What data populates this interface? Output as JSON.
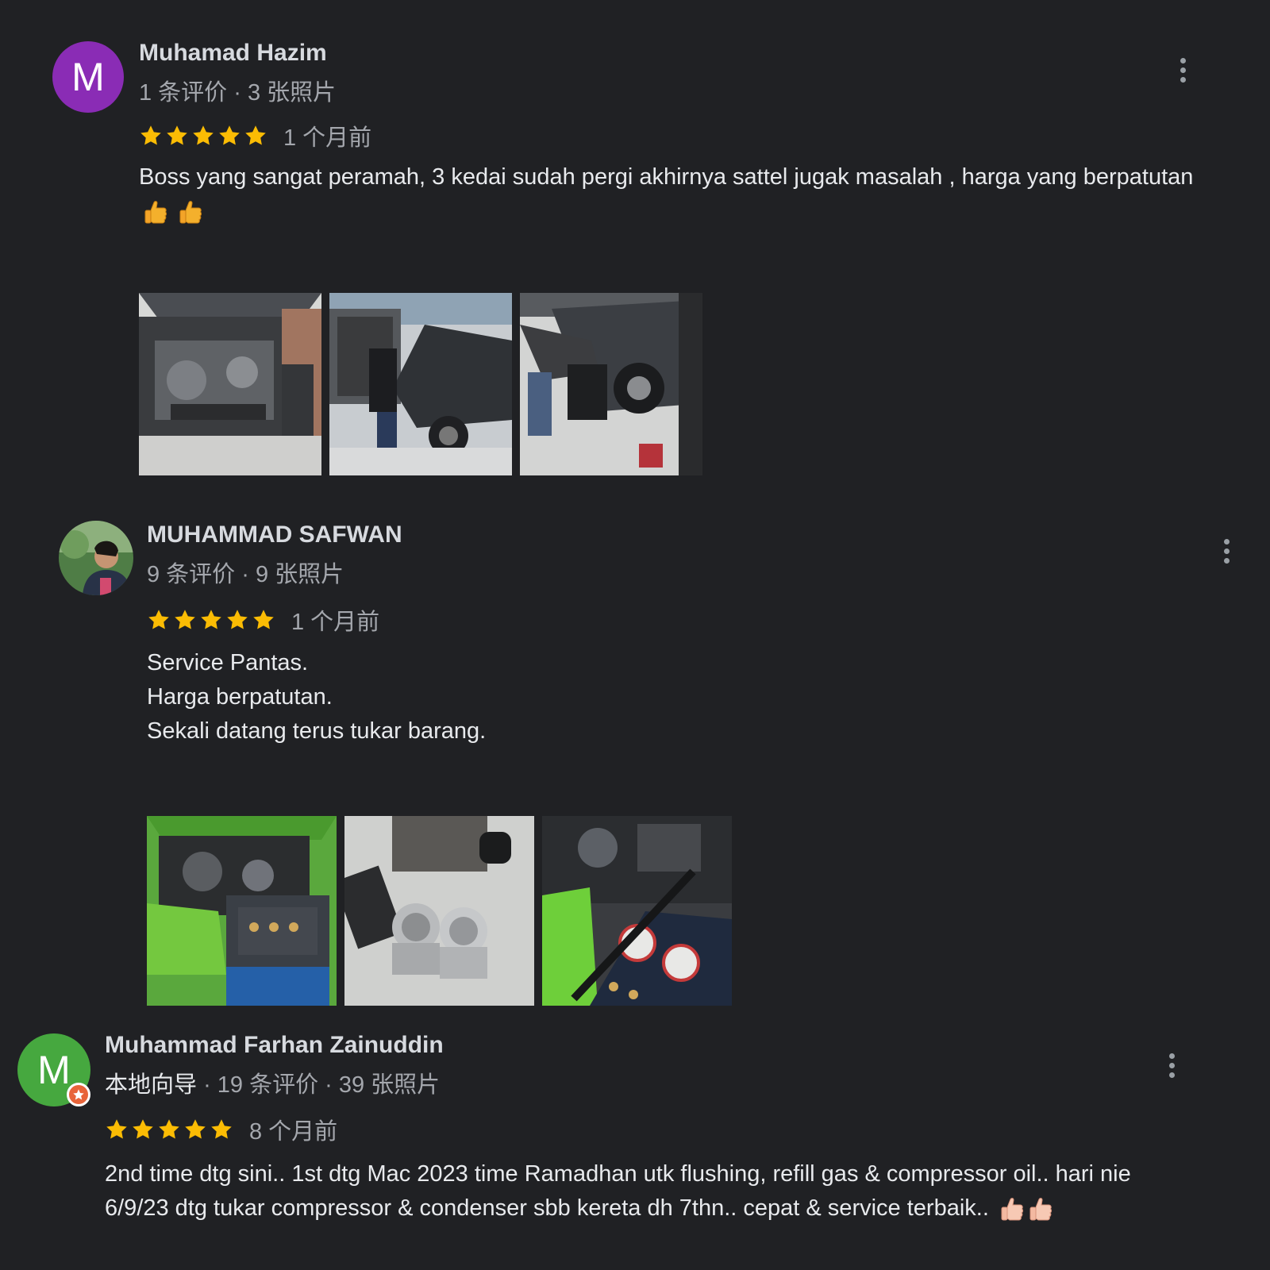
{
  "colors": {
    "background": "#202124",
    "star": "#fbbc04",
    "avatar_purple": "#8a2cb5",
    "avatar_green": "#46a83f",
    "guide_badge": "#e8643a"
  },
  "reviews": [
    {
      "author": "Muhamad Hazim",
      "avatar_letter": "M",
      "meta": "1 条评价 · 3 张照片",
      "rating": 5,
      "date": "1 个月前",
      "text_lines": [
        "Boss yang sangat peramah, 3 kedai sudah pergi akhirnya sattel jugak masalah , harga yang berpatutan"
      ],
      "emoji": [
        "thumbs-up",
        "thumbs-up"
      ],
      "photo_count": 3,
      "photo_icons": [
        "car-engine-photo",
        "mechanic-at-car-photo",
        "mechanic-bending-photo"
      ],
      "more_icon": "more-vert-icon"
    },
    {
      "author": "MUHAMMAD SAFWAN",
      "avatar_icon": "profile-photo",
      "meta": "9 条评价 · 9 张照片",
      "rating": 5,
      "date": "1 个月前",
      "text_lines": [
        "Service Pantas.",
        "Harga berpatutan.",
        "Sekali datang terus tukar barang."
      ],
      "photo_count": 3,
      "photo_icons": [
        "green-car-engine-photo",
        "compressor-parts-photo",
        "gas-gauge-machine-photo"
      ],
      "more_icon": "more-vert-icon"
    },
    {
      "author": "Muhammad Farhan Zainuddin",
      "avatar_letter": "M",
      "badge_icon": "local-guide-badge-icon",
      "meta_guide": "本地向导",
      "meta": " · 19 条评价 · 39 张照片",
      "rating": 5,
      "date": "8 个月前",
      "text_lines": [
        "2nd time dtg sini.. 1st dtg Mac 2023 time Ramadhan utk flushing, refill gas & compressor oil.. hari nie",
        "6/9/23 dtg tukar compressor & condenser sbb kereta dh 7thn.. cepat & service terbaik.."
      ],
      "emoji": [
        "thumbs-up",
        "thumbs-up"
      ],
      "more_icon": "more-vert-icon"
    }
  ]
}
